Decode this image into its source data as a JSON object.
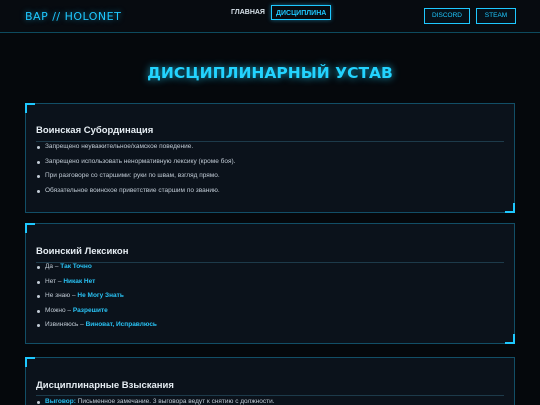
{
  "header": {
    "logo": "ВАР // HOLONET",
    "nav": [
      {
        "label": "ГЛАВНАЯ"
      },
      {
        "label": "ДИСЦИПЛИНА"
      }
    ],
    "buttons": [
      {
        "label": "DISCORD"
      },
      {
        "label": "STEAM"
      }
    ]
  },
  "main": {
    "title": "ДИСЦИПЛИНАРНЫЙ УСТАВ",
    "sections": [
      {
        "title": "Воинская Субординация",
        "items": [
          "Запрещено неуважительное/хамское поведение.",
          "Запрещено использовать ненормативную лексику (кроме боя).",
          "При разговоре со старшими: руки по швам, взгляд прямо.",
          "Обязательное воинское приветствие старшим по званию."
        ]
      },
      {
        "title": "Воинский Лексикон",
        "items": [
          {
            "term": "Да",
            "sep": " – ",
            "meaning": "Так Точно"
          },
          {
            "term": "Нет",
            "sep": " – ",
            "meaning": "Никак Нет"
          },
          {
            "term": "Не знаю",
            "sep": " – ",
            "meaning": "Не Могу Знать"
          },
          {
            "term": "Можно",
            "sep": " – ",
            "meaning": "Разрешите"
          },
          {
            "term": "Извиняюсь",
            "sep": " – ",
            "meaning": "Виноват, Исправлюсь"
          }
        ]
      },
      {
        "title": "Дисциплинарные Взыскания",
        "items": [
          {
            "term": "Выговор:",
            "text": " Письменное замечание. 3 выговора ведут к снятию с должности."
          }
        ]
      }
    ]
  },
  "colors": {
    "accent": "#1ec8ff",
    "background": "#05080c",
    "card": "#0b121b"
  }
}
